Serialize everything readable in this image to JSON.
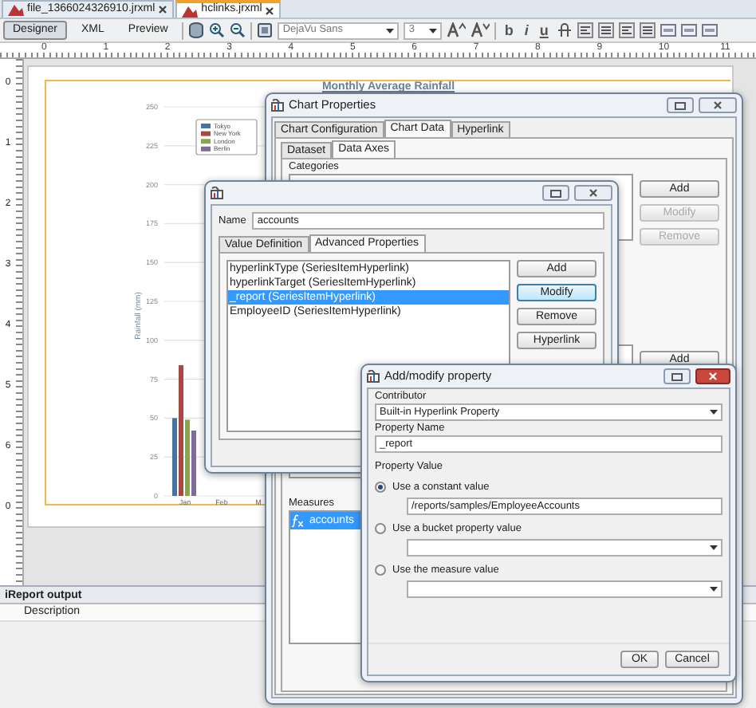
{
  "file_tabs": [
    {
      "label": "file_1366024326910.jrxml",
      "selected": false
    },
    {
      "label": "hclinks.jrxml",
      "selected": true
    }
  ],
  "toolbar": {
    "views": [
      {
        "label": "Designer",
        "selected": true
      },
      {
        "label": "XML",
        "selected": false
      },
      {
        "label": "Preview",
        "selected": false
      }
    ],
    "font": "DejaVu Sans",
    "size": "3",
    "styles": [
      "b",
      "i",
      "u"
    ]
  },
  "ruler": {
    "horizontal": [
      "0",
      "1",
      "2",
      "3",
      "4",
      "5",
      "6",
      "7",
      "8",
      "9",
      "10",
      "11"
    ],
    "vertical": [
      "0",
      "1",
      "2",
      "3",
      "4",
      "5",
      "6",
      "0"
    ]
  },
  "report": {
    "title": "Monthly Average Rainfall",
    "chart_data": {
      "type": "bar",
      "ylabel": "Rainfall (mm)",
      "categories": [
        "Jan",
        "Feb",
        "M"
      ],
      "series": [
        {
          "name": "Tokyo",
          "color": "#4572a7",
          "values": [
            50,
            null,
            null
          ]
        },
        {
          "name": "New York",
          "color": "#aa4643",
          "values": [
            84,
            null,
            null
          ]
        },
        {
          "name": "London",
          "color": "#89a54e",
          "values": [
            49,
            null,
            null
          ]
        },
        {
          "name": "Berlin",
          "color": "#80699b",
          "values": [
            42,
            null,
            null
          ]
        }
      ],
      "grid": true,
      "legend": true,
      "ylim": [
        0,
        250
      ],
      "yticks": [
        {
          "value": 0,
          "label": "0"
        },
        25,
        50,
        75,
        100,
        125,
        150,
        175,
        200,
        225,
        250
      ]
    }
  },
  "chart_properties": {
    "title": "Chart Properties",
    "tabs": [
      {
        "label": "Chart Configuration",
        "selected": false
      },
      {
        "label": "Chart Data",
        "selected": true
      },
      {
        "label": "Hyperlink",
        "selected": false
      }
    ],
    "subtabs": [
      {
        "label": "Dataset",
        "selected": false
      },
      {
        "label": "Data Axes",
        "selected": true
      }
    ],
    "categories_label": "Categories",
    "category_buttons": [
      {
        "label": "Add",
        "disabled": false
      },
      {
        "label": "Modify",
        "disabled": true
      },
      {
        "label": "Remove",
        "disabled": true
      }
    ],
    "series_buttons": [
      {
        "label": "Add",
        "disabled": false
      }
    ],
    "measures_label": "Measures",
    "measures": [
      {
        "label": "accounts",
        "selected": true
      }
    ]
  },
  "series_dialog": {
    "name_label": "Name",
    "name": "accounts",
    "tabs": [
      {
        "label": "Value Definition",
        "selected": false
      },
      {
        "label": "Advanced Properties",
        "selected": true
      }
    ],
    "properties": [
      {
        "label": "hyperlinkType (SeriesItemHyperlink)",
        "selected": false
      },
      {
        "label": "hyperlinkTarget (SeriesItemHyperlink)",
        "selected": false
      },
      {
        "label": "_report (SeriesItemHyperlink)",
        "selected": true
      },
      {
        "label": "EmployeeID (SeriesItemHyperlink)",
        "selected": false
      }
    ],
    "buttons": [
      {
        "label": "Add",
        "focused": false
      },
      {
        "label": "Modify",
        "focused": true
      },
      {
        "label": "Remove",
        "focused": false
      },
      {
        "label": "Hyperlink",
        "focused": false
      }
    ]
  },
  "property_dialog": {
    "title": "Add/modify property",
    "contributor_label": "Contributor",
    "contributor": "Built-in Hyperlink Property",
    "name_label": "Property Name",
    "name": "_report",
    "value_label": "Property Value",
    "options": [
      {
        "label": "Use a constant value",
        "selected": true,
        "kind": "text",
        "value": "/reports/samples/EmployeeAccounts"
      },
      {
        "label": "Use a bucket property value",
        "selected": false,
        "kind": "combo"
      },
      {
        "label": "Use the measure value",
        "selected": false,
        "kind": "combo"
      }
    ],
    "buttons": [
      "OK",
      "Cancel"
    ]
  },
  "output_panel": {
    "title": "iReport output",
    "column": "Description"
  }
}
